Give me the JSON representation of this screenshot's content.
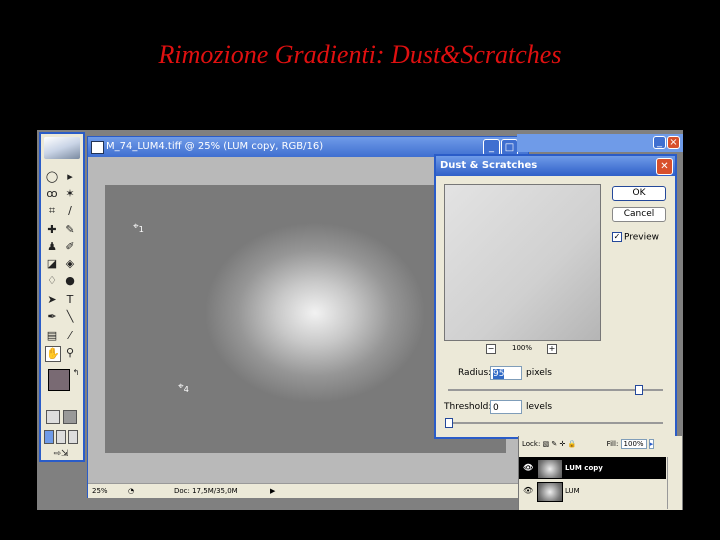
{
  "slide": {
    "title": "Rimozione Gradienti: Dust&Scratches"
  },
  "document": {
    "title": "M_74_LUM4.tiff @ 25% (LUM copy, RGB/16)",
    "status_zoom": "25%",
    "status_doc": "Doc: 17,5M/35,0M",
    "samplers": [
      "1",
      "4"
    ]
  },
  "dialog": {
    "title": "Dust & Scratches",
    "ok_label": "OK",
    "cancel_label": "Cancel",
    "preview_label": "Preview",
    "preview_checked": true,
    "zoom_label": "100%",
    "radius_label": "Radius:",
    "radius_value": "95",
    "radius_unit": "pixels",
    "threshold_label": "Threshold:",
    "threshold_value": "0",
    "threshold_unit": "levels"
  },
  "layers": {
    "lock_label": "Lock:",
    "fill_label": "Fill:",
    "fill_value": "100%",
    "items": [
      {
        "name": "LUM copy",
        "selected": true
      },
      {
        "name": "LUM",
        "selected": false
      }
    ]
  },
  "colors": {
    "selection": "#000000",
    "title_red": "#e01010",
    "xp_blue": "#2a5cc8",
    "foreground": "#796a73"
  }
}
